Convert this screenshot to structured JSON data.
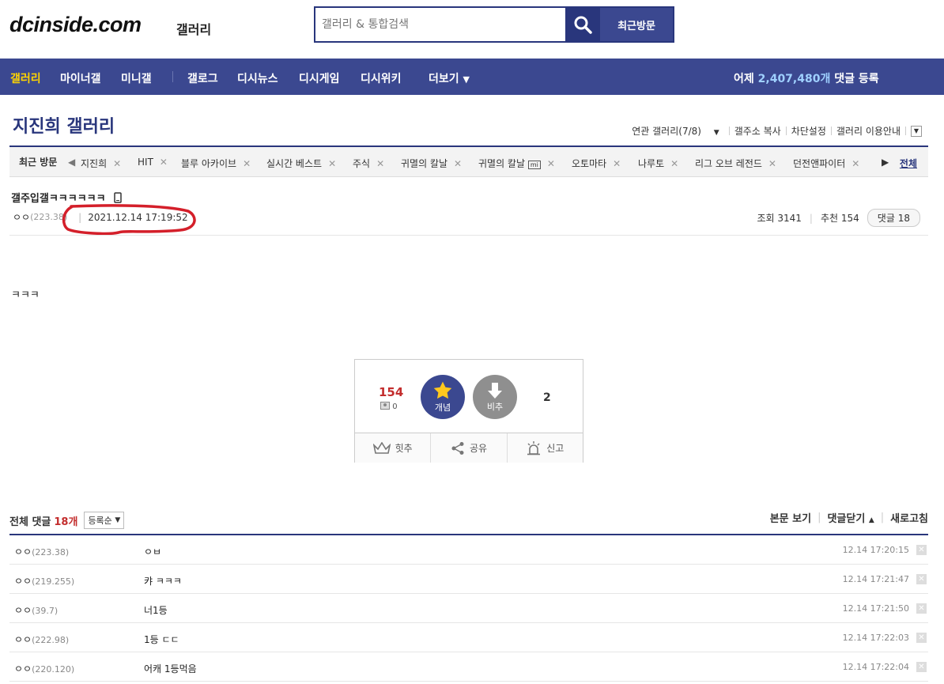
{
  "header": {
    "logo": "dcinside.com",
    "logo_sub": "갤러리",
    "search_placeholder": "갤러리 & 통합검색",
    "recent_button": "최근방문"
  },
  "nav": {
    "items": [
      "갤러리",
      "마이너갤",
      "미니갤",
      "갤로그",
      "디시뉴스",
      "디시게임",
      "디시위키",
      "더보기"
    ],
    "stat_prefix": "어제",
    "stat_number": "2,407,480개",
    "stat_suffix": "댓글 등록"
  },
  "gallery": {
    "title": "지진희 갤러리",
    "tools": [
      "연관 갤러리(7/8)",
      "갤주소 복사",
      "차단설정",
      "갤러리 이용안내"
    ]
  },
  "recent_tabs": {
    "head": "최근 방문",
    "items": [
      "지진희",
      "HIT",
      "블루 아카이브",
      "실시간 베스트",
      "주식",
      "귀멸의 칼날",
      "귀멸의 칼날",
      "오토마타",
      "나루토",
      "리그 오브 레전드",
      "던전앤파이터"
    ],
    "mini_badge": "mi",
    "all": "전체"
  },
  "post": {
    "title": "갤주입갤ㅋㅋㅋㅋㅋㅋ",
    "author": "ㅇㅇ",
    "ip": "(223.38)",
    "date": "2021.12.14 17:19:52",
    "views_label": "조회",
    "views": "3141",
    "recommend_label": "추천",
    "recommend": "154",
    "comments_label": "댓글",
    "comments": "18",
    "body": "ㅋㅋㅋ"
  },
  "vote": {
    "up_count": "154",
    "fixed_count": "0",
    "up_label": "개념",
    "down_label": "비추",
    "down_count": "2",
    "actions": [
      "힛추",
      "공유",
      "신고"
    ]
  },
  "comments": {
    "total_label": "전체 댓글",
    "count": "18개",
    "sort": "등록순",
    "right_actions": [
      "본문 보기",
      "댓글닫기",
      "새로고침"
    ],
    "rows": [
      {
        "nick": "ㅇㅇ",
        "ip": "(223.38)",
        "text": "ㅇㅂ",
        "date": "12.14 17:20:15"
      },
      {
        "nick": "ㅇㅇ",
        "ip": "(219.255)",
        "text": "캬 ㅋㅋㅋ",
        "date": "12.14 17:21:47"
      },
      {
        "nick": "ㅇㅇ",
        "ip": "(39.7)",
        "text": "너1등",
        "date": "12.14 17:21:50"
      },
      {
        "nick": "ㅇㅇ",
        "ip": "(222.98)",
        "text": "1등 ㄷㄷ",
        "date": "12.14 17:22:03"
      },
      {
        "nick": "ㅇㅇ",
        "ip": "(220.120)",
        "text": "어캐 1등먹음",
        "date": "12.14 17:22:04"
      }
    ]
  },
  "colors": {
    "brand": "#3b4890",
    "accent_red": "#c32d2d",
    "highlight_nav": "#ffd400"
  }
}
